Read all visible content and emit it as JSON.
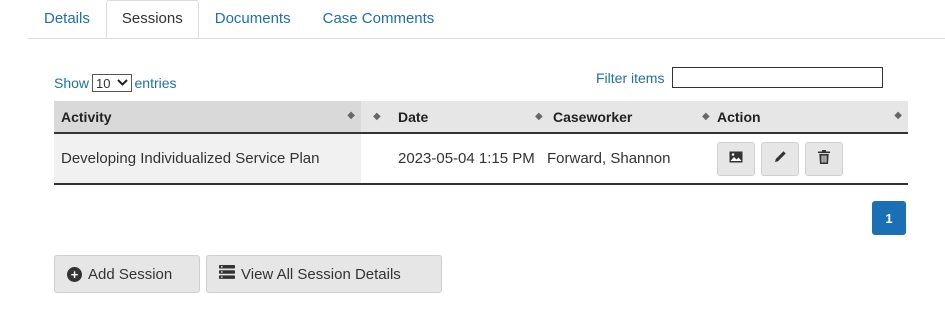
{
  "tabs": [
    {
      "label": "Details",
      "active": false
    },
    {
      "label": "Sessions",
      "active": true
    },
    {
      "label": "Documents",
      "active": false
    },
    {
      "label": "Case Comments",
      "active": false
    }
  ],
  "controls": {
    "show_label": "Show",
    "entries_value": "10",
    "entries_label": "entries",
    "filter_label": "Filter items",
    "filter_value": ""
  },
  "table": {
    "headers": [
      "Activity",
      "Date",
      "Caseworker",
      "Action"
    ],
    "rows": [
      {
        "activity": "Developing Individualized Service Plan",
        "date": "2023-05-04 1:15 PM",
        "caseworker": "Forward, Shannon"
      }
    ]
  },
  "pagination": {
    "current_page": "1"
  },
  "buttons": {
    "add_session": "Add Session",
    "view_all": "View All Session Details"
  },
  "colors": {
    "link": "#1f6fa8",
    "primary": "#1a6fb5"
  }
}
